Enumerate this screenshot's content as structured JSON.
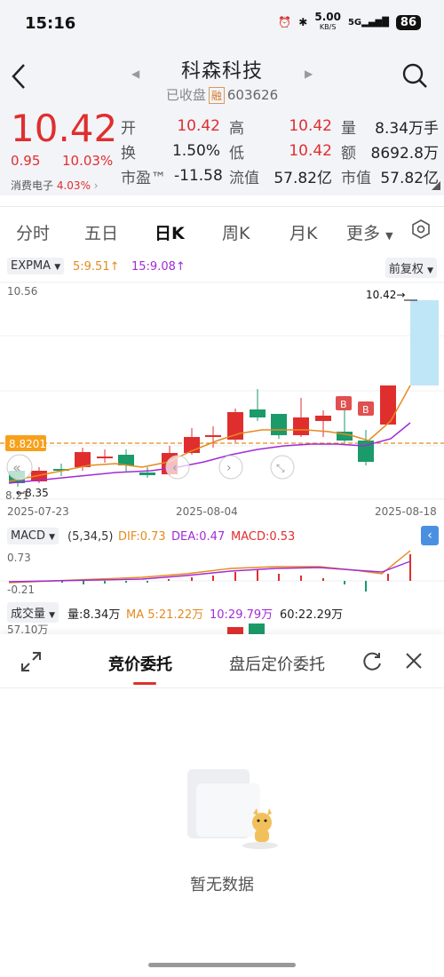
{
  "status_bar": {
    "time": "15:16",
    "speed": "5.00",
    "speed_unit": "KB/S",
    "network": "5G",
    "battery": "86"
  },
  "header": {
    "stock_name": "科森科技",
    "market_status": "已收盘",
    "margin_badge": "融",
    "stock_code": "603626"
  },
  "quote": {
    "price": "10.42",
    "change": "0.95",
    "change_pct": "10.03%",
    "sector": "消费电子",
    "sector_pct": "4.03%",
    "fields": [
      {
        "label": "开",
        "value": "10.42",
        "label2": "高",
        "value2": "10.42",
        "label3": "量",
        "value3": "8.34万手"
      },
      {
        "label": "换",
        "value": "1.50%",
        "label2": "低",
        "value2": "10.42",
        "label3": "额",
        "value3": "8692.8万"
      },
      {
        "label": "市盈™",
        "value": "-11.58",
        "label2": "流值",
        "value2": "57.82亿",
        "label3": "市值",
        "value3": "57.82亿"
      }
    ]
  },
  "tabs": {
    "items": [
      "分时",
      "五日",
      "日K",
      "周K",
      "月K",
      "更多"
    ],
    "active": "日K"
  },
  "chart": {
    "indicator": "EXPMA",
    "ema5": "5:9.51↑",
    "ema15": "15:9.08↑",
    "adjust": "前复权",
    "y_high": "10.56",
    "y_low": "8.21",
    "price_line": "8.8201",
    "last_label": "10.42",
    "low_label": "8.35",
    "dates": [
      "2025-07-23",
      "2025-08-04",
      "2025-08-18"
    ],
    "marker": "B",
    "colors": {
      "up": "#e02e2e",
      "down": "#1b9a6a",
      "ema5": "#e58a1f",
      "ema15": "#a12bd6"
    }
  },
  "macd": {
    "label": "MACD",
    "params": "(5,34,5)",
    "dif": "DIF:0.73",
    "dea": "DEA:0.47",
    "macd": "MACD:0.53",
    "y_high": "0.73",
    "y_low": "-0.21"
  },
  "volume": {
    "label": "成交量",
    "vol": "量:8.34万",
    "ma5": "MA 5:21.22万",
    "ma10": "10:29.79万",
    "ma60": "60:22.29万",
    "y_high": "57.10万"
  },
  "panel": {
    "tab_active": "竞价委托",
    "tab_other": "盘后定价委托",
    "empty": "暂无数据"
  }
}
